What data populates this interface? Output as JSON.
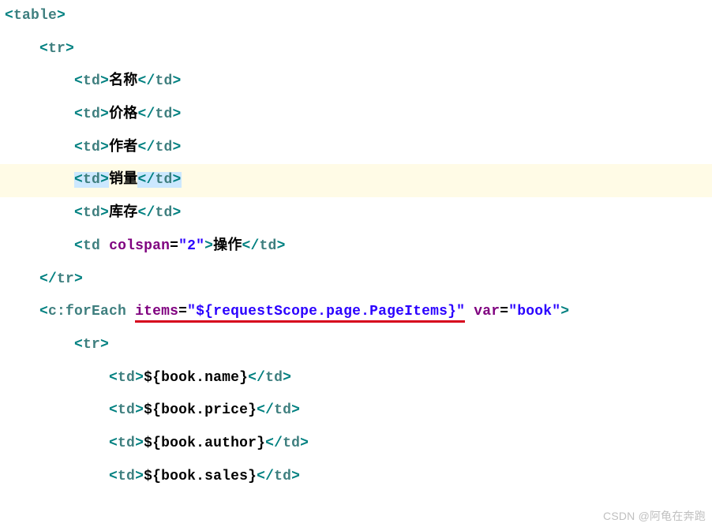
{
  "tags": {
    "table": "table",
    "tr": "tr",
    "td": "td",
    "c_foreach": "c:forEach"
  },
  "attrs": {
    "colspan": "colspan",
    "items": "items",
    "var": "var"
  },
  "values": {
    "colspan_2": "\"2\"",
    "foreach_items": "\"${requestScope.page.PageItems}\"",
    "foreach_var": "\"book\""
  },
  "text": {
    "name_label": "名称",
    "price_label": "价格",
    "author_label": "作者",
    "sales_label": "销量",
    "stock_label": "库存",
    "ops_label": "操作",
    "book_name": "${book.name}",
    "book_price": "${book.price}",
    "book_author": "${book.author}",
    "book_sales": "${book.sales}"
  },
  "indent": {
    "s0": "",
    "s4": "    ",
    "s8": "        ",
    "s12": "            "
  },
  "watermark": "CSDN @阿龟在奔跑"
}
